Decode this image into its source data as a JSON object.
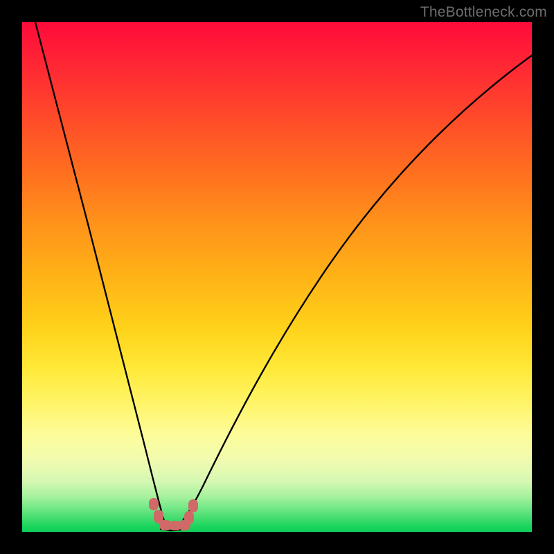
{
  "watermark": "TheBottleneck.com",
  "chart_data": {
    "type": "line",
    "title": "",
    "xlabel": "",
    "ylabel": "",
    "xlim": [
      0,
      100
    ],
    "ylim": [
      0,
      100
    ],
    "x": [
      0,
      4,
      8,
      12,
      16,
      20,
      23,
      25,
      27,
      28.5,
      30,
      32,
      34,
      37,
      41,
      46,
      52,
      60,
      70,
      82,
      100
    ],
    "values": [
      100,
      86,
      72,
      58,
      44,
      30,
      17,
      8,
      3,
      0.5,
      0.5,
      3,
      8,
      17,
      29,
      42,
      54,
      66,
      77,
      86,
      94
    ],
    "series": [
      {
        "name": "bottleneck-curve",
        "values": [
          100,
          86,
          72,
          58,
          44,
          30,
          17,
          8,
          3,
          0.5,
          0.5,
          3,
          8,
          17,
          29,
          42,
          54,
          66,
          77,
          86,
          94
        ]
      }
    ],
    "markers": {
      "color": "#cf6a68",
      "points_xy": [
        [
          25.7,
          5.4
        ],
        [
          26.6,
          2.7
        ],
        [
          27.7,
          1.1
        ],
        [
          29.3,
          1.1
        ],
        [
          30.9,
          1.1
        ],
        [
          32.2,
          2.4
        ],
        [
          33.2,
          5.0
        ]
      ]
    },
    "background": "vertical-gradient red→orange→yellow→green"
  }
}
